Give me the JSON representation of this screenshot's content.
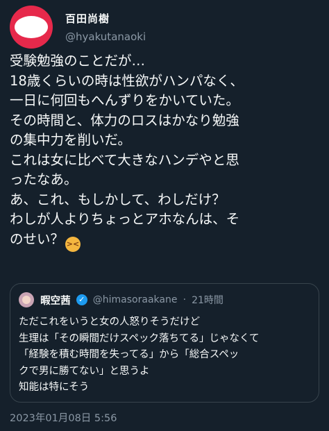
{
  "author": {
    "name": "百田尚樹",
    "handle": "@hyakutanaoki"
  },
  "tweet": {
    "lines": [
      "受験勉強のことだが…",
      "18歳くらいの時は性欲がハンパなく、",
      "一日に何回もへんずりをかいていた。",
      "その時間と、体力のロスはかなり勉強",
      "の集中力を削いだ。",
      "これは女に比べて大きなハンデやと思",
      "ったなあ。",
      "あ、これ、もしかして、わしだけ？",
      "わしが人よりちょっとアホなんは、そ",
      "のせい？"
    ],
    "emoji": "confounded-face-emoji"
  },
  "quote": {
    "name": "暇空茜",
    "handle": "@himasoraakane",
    "separator": "·",
    "time": "21時間",
    "lines": [
      "ただこれをいうと女の人怒りそうだけど",
      "生理は「その瞬間だけスペック落ちてる」じゃなくて",
      "「経験を積む時間を失ってる」から「総合スペッ",
      "クで男に勝てない」と思うよ",
      "知能は特にそう"
    ]
  },
  "timestamp": "2023年01月08日 5:56",
  "colors": {
    "background": "#15202b",
    "text": "#f7f9f9",
    "secondary_text": "#8b98a5",
    "border": "#38444d",
    "avatar_red": "#e6294b",
    "verified_blue": "#1d9bf0"
  }
}
